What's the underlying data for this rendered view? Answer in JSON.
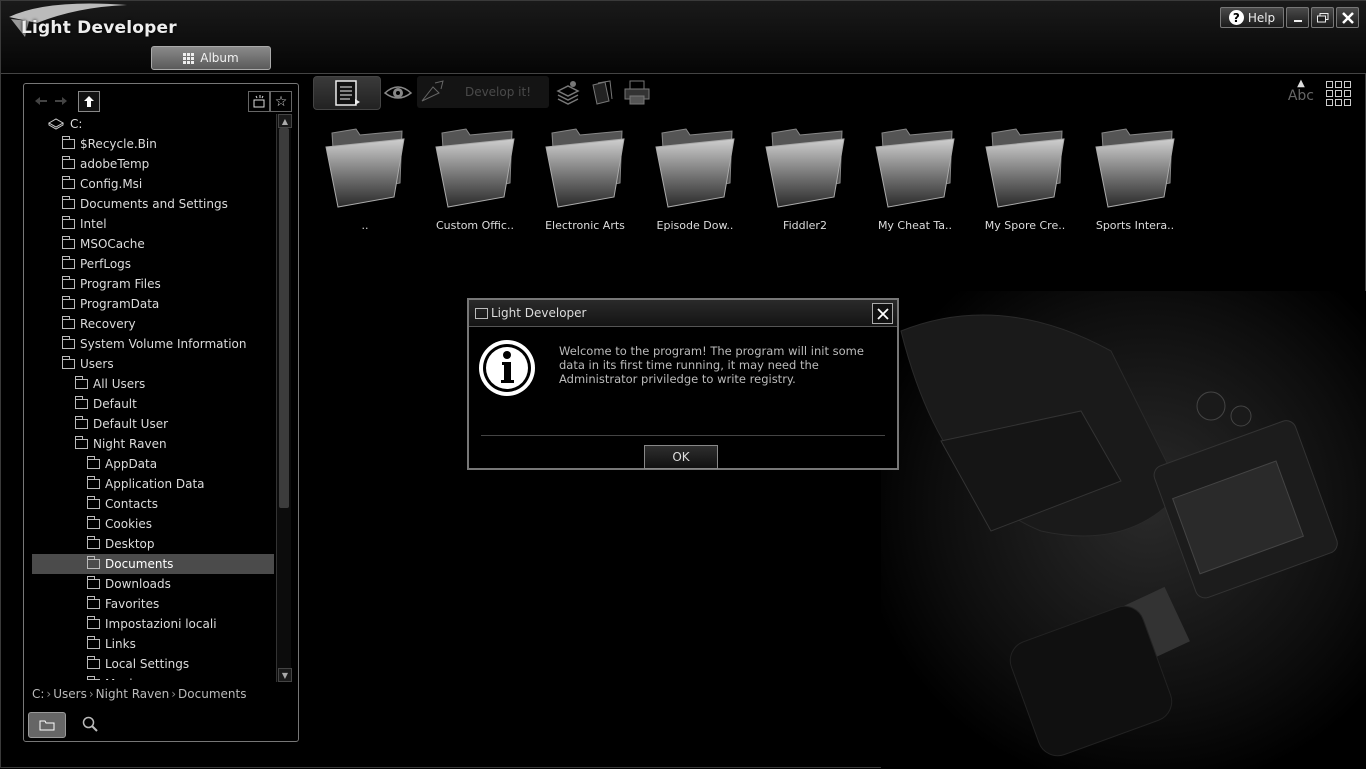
{
  "app": {
    "title": "Light Developer",
    "help_label": "Help",
    "album_tab": "Album"
  },
  "toolbar": {
    "develop_label": "Develop it!",
    "sort_label": "Abc"
  },
  "tree": {
    "root": "C:",
    "items": [
      {
        "label": "$Recycle.Bin",
        "level": 1
      },
      {
        "label": "adobeTemp",
        "level": 1
      },
      {
        "label": "Config.Msi",
        "level": 1
      },
      {
        "label": "Documents and Settings",
        "level": 1
      },
      {
        "label": "Intel",
        "level": 1
      },
      {
        "label": "MSOCache",
        "level": 1
      },
      {
        "label": "PerfLogs",
        "level": 1
      },
      {
        "label": "Program Files",
        "level": 1
      },
      {
        "label": "ProgramData",
        "level": 1
      },
      {
        "label": "Recovery",
        "level": 1
      },
      {
        "label": "System Volume Information",
        "level": 1
      },
      {
        "label": "Users",
        "level": 1
      },
      {
        "label": "All Users",
        "level": 2
      },
      {
        "label": "Default",
        "level": 2
      },
      {
        "label": "Default User",
        "level": 2
      },
      {
        "label": "Night Raven",
        "level": 2
      },
      {
        "label": "AppData",
        "level": 3
      },
      {
        "label": "Application Data",
        "level": 3
      },
      {
        "label": "Contacts",
        "level": 3
      },
      {
        "label": "Cookies",
        "level": 3
      },
      {
        "label": "Desktop",
        "level": 3
      },
      {
        "label": "Documents",
        "level": 3,
        "selected": true
      },
      {
        "label": "Downloads",
        "level": 3
      },
      {
        "label": "Favorites",
        "level": 3
      },
      {
        "label": "Impostazioni locali",
        "level": 3
      },
      {
        "label": "Links",
        "level": 3
      },
      {
        "label": "Local Settings",
        "level": 3
      },
      {
        "label": "Music",
        "level": 3
      }
    ]
  },
  "breadcrumb": [
    "C:",
    "Users",
    "Night Raven",
    "Documents"
  ],
  "folders": [
    "..",
    "Custom Offic..",
    "Electronic Arts",
    "Episode Dow..",
    "Fiddler2",
    "My Cheat Ta..",
    "My Spore Cre..",
    "Sports Intera.."
  ],
  "dialog": {
    "title": "Light Developer",
    "message": "Welcome to the program! The program will init some data in its first time running, it may need the Administrator priviledge to write registry.",
    "ok_label": "OK"
  }
}
